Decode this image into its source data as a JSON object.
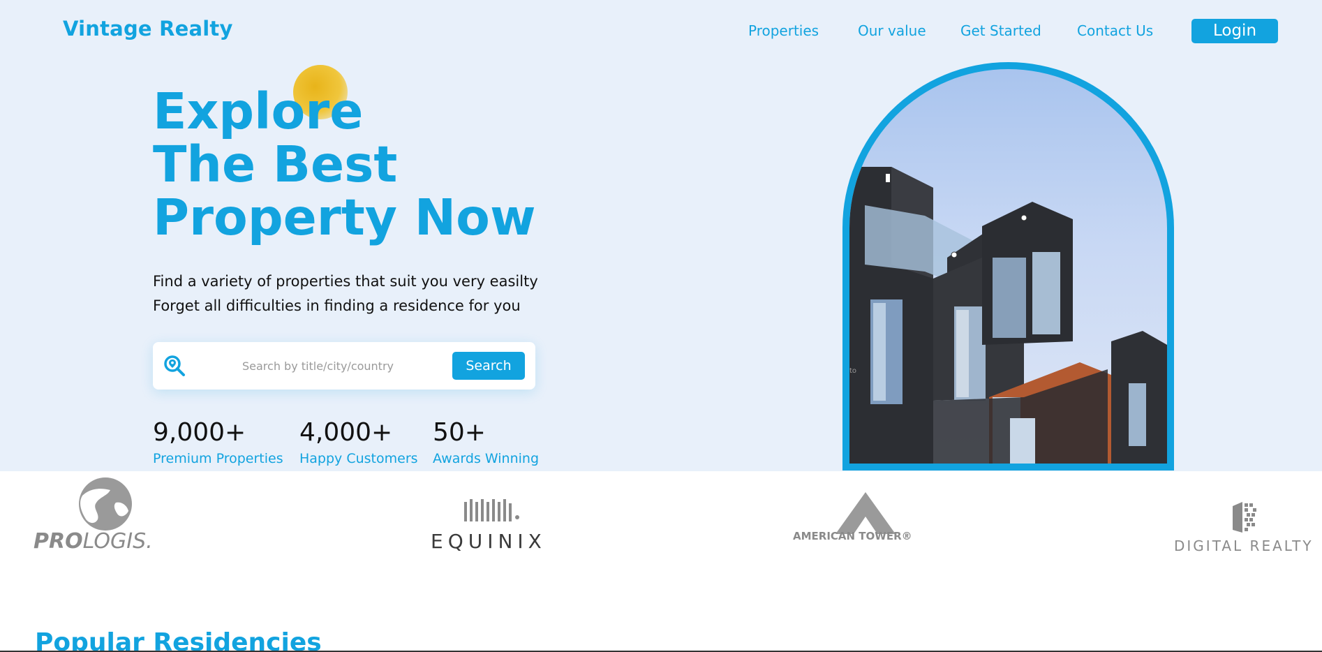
{
  "brand": {
    "name": "Vintage Realty"
  },
  "nav": {
    "items": [
      {
        "label": "Properties"
      },
      {
        "label": "Our value"
      },
      {
        "label": "Get Started"
      },
      {
        "label": "Contact Us"
      }
    ],
    "login_label": "Login"
  },
  "hero": {
    "title_lines": [
      "Explore",
      "The Best",
      "Property Now"
    ],
    "subtitle_lines": [
      "Find a variety of properties that suit you very easilty",
      "Forget all difficulties in finding a residence for you"
    ],
    "search": {
      "placeholder": "Search by title/city/country",
      "button_label": "Search",
      "icon": "location-search-icon"
    },
    "stats": [
      {
        "value": "9,000+",
        "label": "Premium Properties"
      },
      {
        "value": "4,000+",
        "label": "Happy Customers"
      },
      {
        "value": "50+",
        "label": "Awards Winning"
      }
    ],
    "image_alt_text": "to"
  },
  "partners": [
    {
      "name": "PROLOGIS",
      "pre": "PRO",
      "post": "LOGIS",
      "mark": "."
    },
    {
      "name": "EQUINIX"
    },
    {
      "name": "AMERICAN TOWER",
      "mark": "®"
    },
    {
      "name": "DIGITAL REALTY"
    }
  ],
  "sections": {
    "popular_title": "Popular Residencies"
  },
  "colors": {
    "accent": "#12a3df",
    "hero_bg": "#e8f0fa",
    "sun": "#eab51f",
    "partner_gray": "#8a8a8a"
  }
}
